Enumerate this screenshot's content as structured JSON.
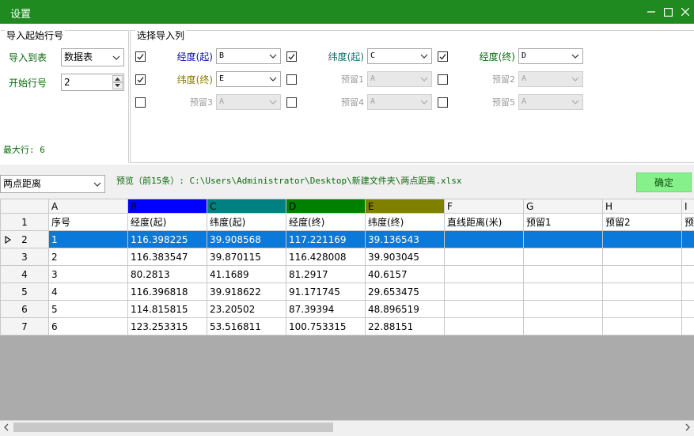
{
  "window": {
    "title": "设置"
  },
  "import_start": {
    "group_title": "导入起始行号",
    "import_to_label": "导入到表",
    "import_to_value": "数据表",
    "start_row_label": "开始行号",
    "start_row_value": "2",
    "max_rows": "最大行: 6"
  },
  "columns_group": {
    "title": "选择导入列",
    "items": [
      {
        "label": "经度(起)",
        "value": "B",
        "checked": true,
        "enabled": true
      },
      {
        "label": "纬度(起)",
        "value": "C",
        "checked": true,
        "enabled": true
      },
      {
        "label": "经度(终)",
        "value": "D",
        "checked": true,
        "enabled": true
      },
      {
        "label": "纬度(终)",
        "value": "E",
        "checked": true,
        "enabled": true
      },
      {
        "label": "预留1",
        "value": "A",
        "checked": false,
        "enabled": false
      },
      {
        "label": "预留2",
        "value": "A",
        "checked": false,
        "enabled": false
      },
      {
        "label": "预留3",
        "value": "A",
        "checked": false,
        "enabled": false
      },
      {
        "label": "预留4",
        "value": "A",
        "checked": false,
        "enabled": false
      },
      {
        "label": "预留5",
        "value": "A",
        "checked": false,
        "enabled": false
      }
    ]
  },
  "mode_select": {
    "value": "两点距离"
  },
  "preview": {
    "text": "预览（前15条）: C:\\Users\\Administrator\\Desktop\\新建文件夹\\两点距离.xlsx"
  },
  "ok_button": {
    "label": "确定"
  },
  "colors": {
    "title_bg": "#1f8a1f",
    "col_b": "#0000ff",
    "col_c": "#008080",
    "col_d": "#008000",
    "col_e": "#808000",
    "selected_row": "#0a79d9",
    "ok_bg": "#86f08a"
  },
  "grid": {
    "col_letters": [
      "A",
      "B",
      "C",
      "D",
      "E",
      "F",
      "G",
      "H",
      "I"
    ],
    "rows": [
      {
        "num": "1",
        "cells": [
          "序号",
          "经度(起)",
          "纬度(起)",
          "经度(终)",
          "纬度(终)",
          "直线距离(米)",
          "预留1",
          "预留2",
          "预"
        ]
      },
      {
        "num": "2",
        "cells": [
          "1",
          "116.398225",
          "39.908568",
          "117.221169",
          "39.136543",
          "",
          "",
          "",
          ""
        ]
      },
      {
        "num": "3",
        "cells": [
          "2",
          "116.383547",
          "39.870115",
          "116.428008",
          "39.903045",
          "",
          "",
          "",
          ""
        ]
      },
      {
        "num": "4",
        "cells": [
          "3",
          "80.2813",
          "41.1689",
          "81.2917",
          "40.6157",
          "",
          "",
          "",
          ""
        ]
      },
      {
        "num": "5",
        "cells": [
          "4",
          "116.396818",
          "39.918622",
          "91.171745",
          "29.653475",
          "",
          "",
          "",
          ""
        ]
      },
      {
        "num": "6",
        "cells": [
          "5",
          "114.815815",
          "23.20502",
          "87.39394",
          "48.896519",
          "",
          "",
          "",
          ""
        ]
      },
      {
        "num": "7",
        "cells": [
          "6",
          "123.253315",
          "53.516811",
          "100.753315",
          "22.88151",
          "",
          "",
          "",
          ""
        ]
      }
    ],
    "selected_row_num": "2"
  }
}
